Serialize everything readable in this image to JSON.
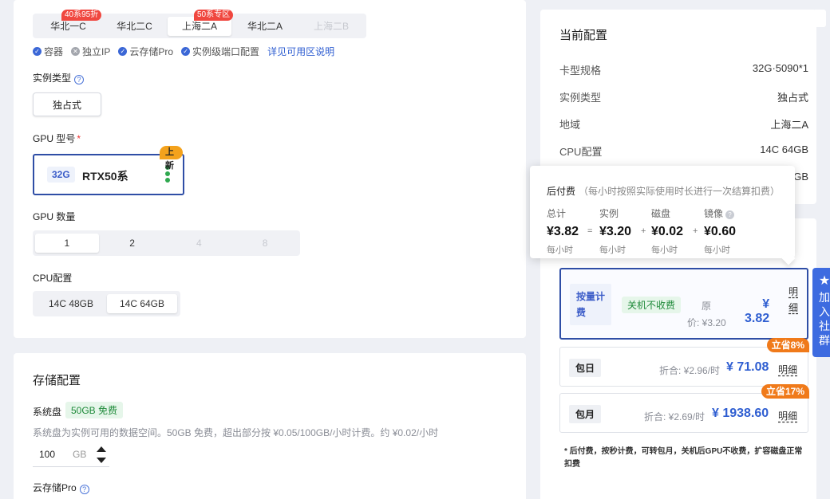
{
  "regions": [
    {
      "label": "华北一C",
      "badge": "40系95折",
      "state": "normal"
    },
    {
      "label": "华北二C",
      "badge": "",
      "state": "normal"
    },
    {
      "label": "上海二A",
      "badge": "50系专区",
      "state": "active"
    },
    {
      "label": "华北二A",
      "badge": "",
      "state": "normal"
    },
    {
      "label": "上海二B",
      "badge": "",
      "state": "disabled"
    }
  ],
  "features": {
    "container": "容器",
    "ip": "独立IP",
    "cloud": "云存储Pro",
    "port": "实例级端口配置",
    "link": "详见可用区说明"
  },
  "instance_type": {
    "label": "实例类型",
    "option": "独占式"
  },
  "gpu": {
    "label": "GPU 型号",
    "mem": "32G",
    "name": "RTX50系",
    "badge": "上新"
  },
  "gpu_count": {
    "label": "GPU 数量",
    "options": [
      "1",
      "2",
      "4",
      "8"
    ],
    "selected": "1"
  },
  "cpu": {
    "label": "CPU配置",
    "options": [
      "14C 48GB",
      "14C 64GB"
    ],
    "selected": "14C 64GB"
  },
  "storage": {
    "title": "存储配置",
    "system_disk": "系统盘",
    "free": "50GB 免费",
    "hint": "系统盘为实例可用的数据空间。50GB 免费，超出部分按 ¥0.05/100GB/小时计费。约 ¥0.02/小时",
    "value": "100",
    "unit": "GB",
    "cloud_label": "云存储Pro"
  },
  "current": {
    "title": "当前配置",
    "rows": [
      {
        "k": "卡型规格",
        "v": "32G·5090*1"
      },
      {
        "k": "实例类型",
        "v": "独占式"
      },
      {
        "k": "地域",
        "v": "上海二A"
      },
      {
        "k": "CPU配置",
        "v": "14C 64GB"
      }
    ],
    "partial": "GB"
  },
  "tooltip": {
    "title": "后付费",
    "sub": "（每小时按照实际使用时长进行一次结算扣费）",
    "cols": [
      {
        "label": "总计",
        "value": "¥3.82",
        "unit": "每小时"
      },
      {
        "label": "实例",
        "value": "¥3.20",
        "unit": "每小时"
      },
      {
        "label": "磁盘",
        "value": "¥0.02",
        "unit": "每小时"
      },
      {
        "label": "镜像",
        "value": "¥0.60",
        "unit": "每小时"
      }
    ],
    "ops": [
      "=",
      "+",
      "+"
    ]
  },
  "plans": {
    "hourly": {
      "name_1": "按量计",
      "name_2": "费",
      "tag": "关机不收费",
      "orig_1": "原",
      "orig_2": "价: ¥3.20",
      "currency": "¥",
      "price": "3.82",
      "detail_1": "明",
      "detail_2": "细"
    },
    "daily": {
      "name": "包日",
      "orig": "折合: ¥2.96/时",
      "price": "¥ 71.08",
      "detail": "明细",
      "save": "立省8%"
    },
    "monthly": {
      "name": "包月",
      "orig": "折合: ¥2.69/时",
      "price": "¥ 1938.60",
      "detail": "明细",
      "save": "立省17%"
    }
  },
  "note": "* 后付费，按秒计费，可转包月，关机后GPU不收费，扩容磁盘正常扣费",
  "float_button": [
    "加",
    "入",
    "社",
    "群"
  ]
}
